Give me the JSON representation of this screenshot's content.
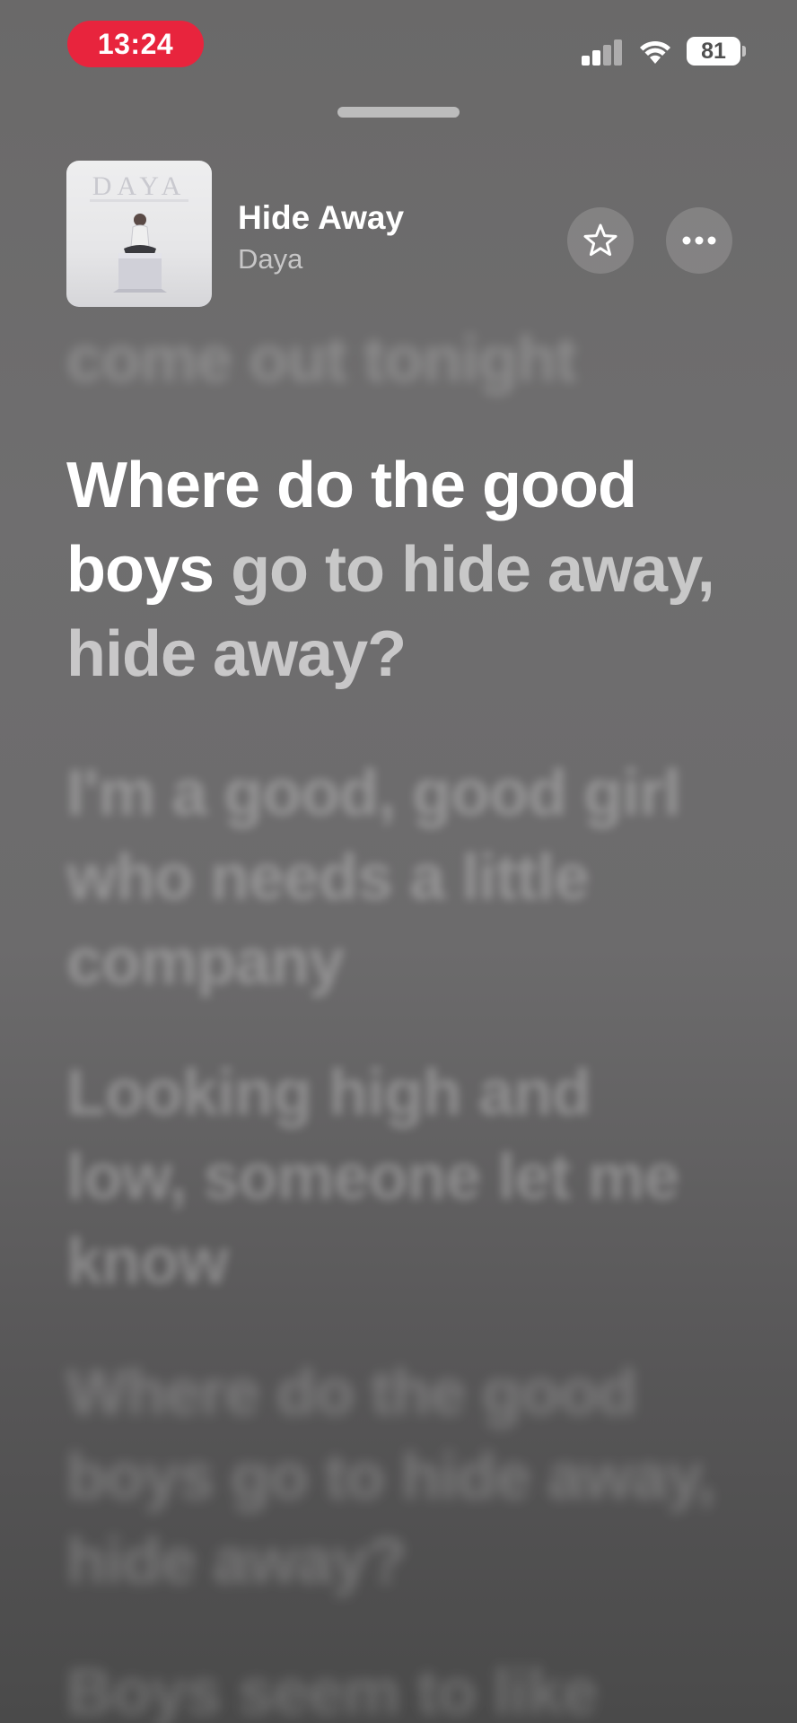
{
  "status_bar": {
    "time": "13:24",
    "battery": "81",
    "icons": [
      "signal-icon",
      "wifi-icon",
      "battery-icon"
    ]
  },
  "now_playing": {
    "title": "Hide Away",
    "artist": "Daya",
    "artwork": {
      "brand_text": "DAYA",
      "icon": "album-artwork"
    },
    "actions": {
      "favorite_icon": "star-icon",
      "more_icon": "ellipsis-icon"
    }
  },
  "lyrics": {
    "previous": "come out tonight",
    "current": {
      "sung": "Where do the good boys",
      "unsung": "go to hide away, hide away?"
    },
    "upcoming": [
      "I'm a good, good girl who needs a little company",
      "Looking high and low, someone let me know",
      "Where do the good boys go to hide away, hide away?",
      "Boys seem to like"
    ]
  },
  "colors": {
    "time_pill": "#e8243d",
    "background_top": "#6a6969",
    "background_bottom": "#4a4a4a"
  }
}
